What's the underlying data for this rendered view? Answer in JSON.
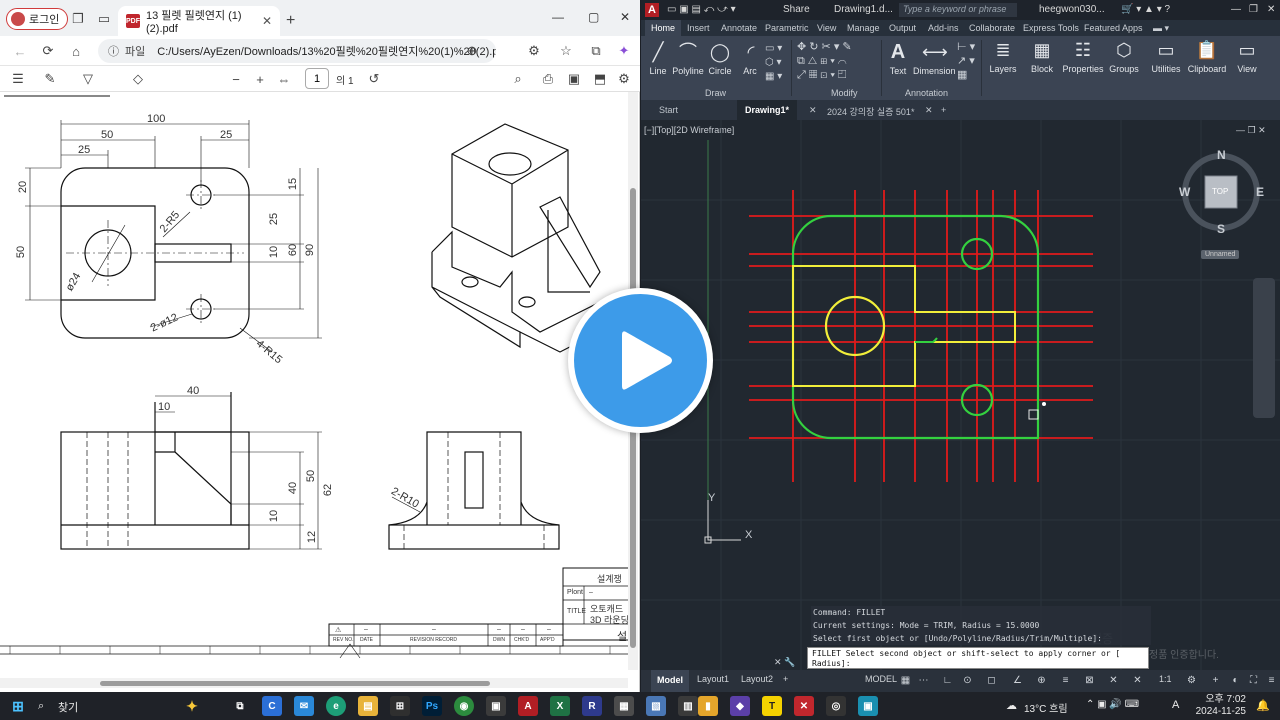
{
  "edge": {
    "profile_label": "로그인",
    "tab_title": "13 필렛 필렛연지 (1) (2).pdf",
    "address_label": "파일",
    "address_url": "C:/Users/AyEzen/Downloads/13%20필렛%20필렛연지%20(1)%20(2).pdf",
    "page_current": "1",
    "page_total": "의 1"
  },
  "drawing": {
    "top_view_dims": [
      "100",
      "50",
      "25",
      "25",
      "20",
      "50",
      "15",
      "25",
      "10",
      "60",
      "90",
      "2-R5",
      "ø24",
      "2-ø12",
      "4-R15"
    ],
    "front_view_dims": [
      "40",
      "10",
      "50",
      "40",
      "10",
      "62",
      "12"
    ],
    "side_view_dims": [
      "2-R10"
    ],
    "title_block": {
      "header": "설계쟁",
      "plant_label": "Plont",
      "plant_value": "–",
      "title_label": "TITLE",
      "title_line1": "오토캐드",
      "title_line2": "3D 라운딩",
      "trailing": "설"
    },
    "revision_headers": [
      "REV NO.",
      "DATE",
      "REVISION RECORD",
      "DWN",
      "CHK'D",
      "APP'D"
    ],
    "revision_row": [
      "–",
      "–",
      "–",
      "–",
      "–"
    ]
  },
  "acad": {
    "share_label": "Share",
    "doc_title": "Drawing1.d...",
    "search_placeholder": "Type a keyword or phrase",
    "user": "heegwon030...",
    "ribbon_tabs": [
      "Home",
      "Insert",
      "Annotate",
      "Parametric",
      "View",
      "Manage",
      "Output",
      "Add-ins",
      "Collaborate",
      "Express Tools",
      "Featured Apps"
    ],
    "draw_tools": [
      "Line",
      "Polyline",
      "Circle",
      "Arc"
    ],
    "draw_panel": "Draw",
    "modify_panel": "Modify",
    "annotation_tools": [
      "Text",
      "Dimension"
    ],
    "annotation_panel": "Annotation",
    "big_tools": [
      "Layers",
      "Block",
      "Properties",
      "Groups",
      "Utilities",
      "Clipboard",
      "View"
    ],
    "doc_tabs": [
      "Start",
      "Drawing1*",
      "2024 강의장 실증 501*"
    ],
    "viewport_label": "[−][Top][2D Wireframe]",
    "viewcube": {
      "n": "N",
      "s": "S",
      "e": "E",
      "w": "W",
      "top": "TOP",
      "ucs": "Unnamed"
    },
    "ucs_x": "X",
    "ucs_y": "Y",
    "command_history": [
      "Command:  FILLET",
      "Current settings: Mode = TRIM, Radius = 15.0000",
      "Select first object or [Undo/Polyline/Radius/Trim/Multiple]:"
    ],
    "command_prompt": "FILLET Select second object or shift-select to apply corner or [",
    "command_prompt_2": "Radius]:",
    "ghost_text_1": "인증",
    "ghost_text_2": "정품 인증합니다.",
    "layout_tabs": [
      "Model",
      "Layout1",
      "Layout2"
    ],
    "model_label": "MODEL",
    "scale": "1:1"
  },
  "taskbar": {
    "search_label": "찾기",
    "weather": "13°C 흐림",
    "time": "오후 7:02",
    "date": "2024-11-25"
  }
}
